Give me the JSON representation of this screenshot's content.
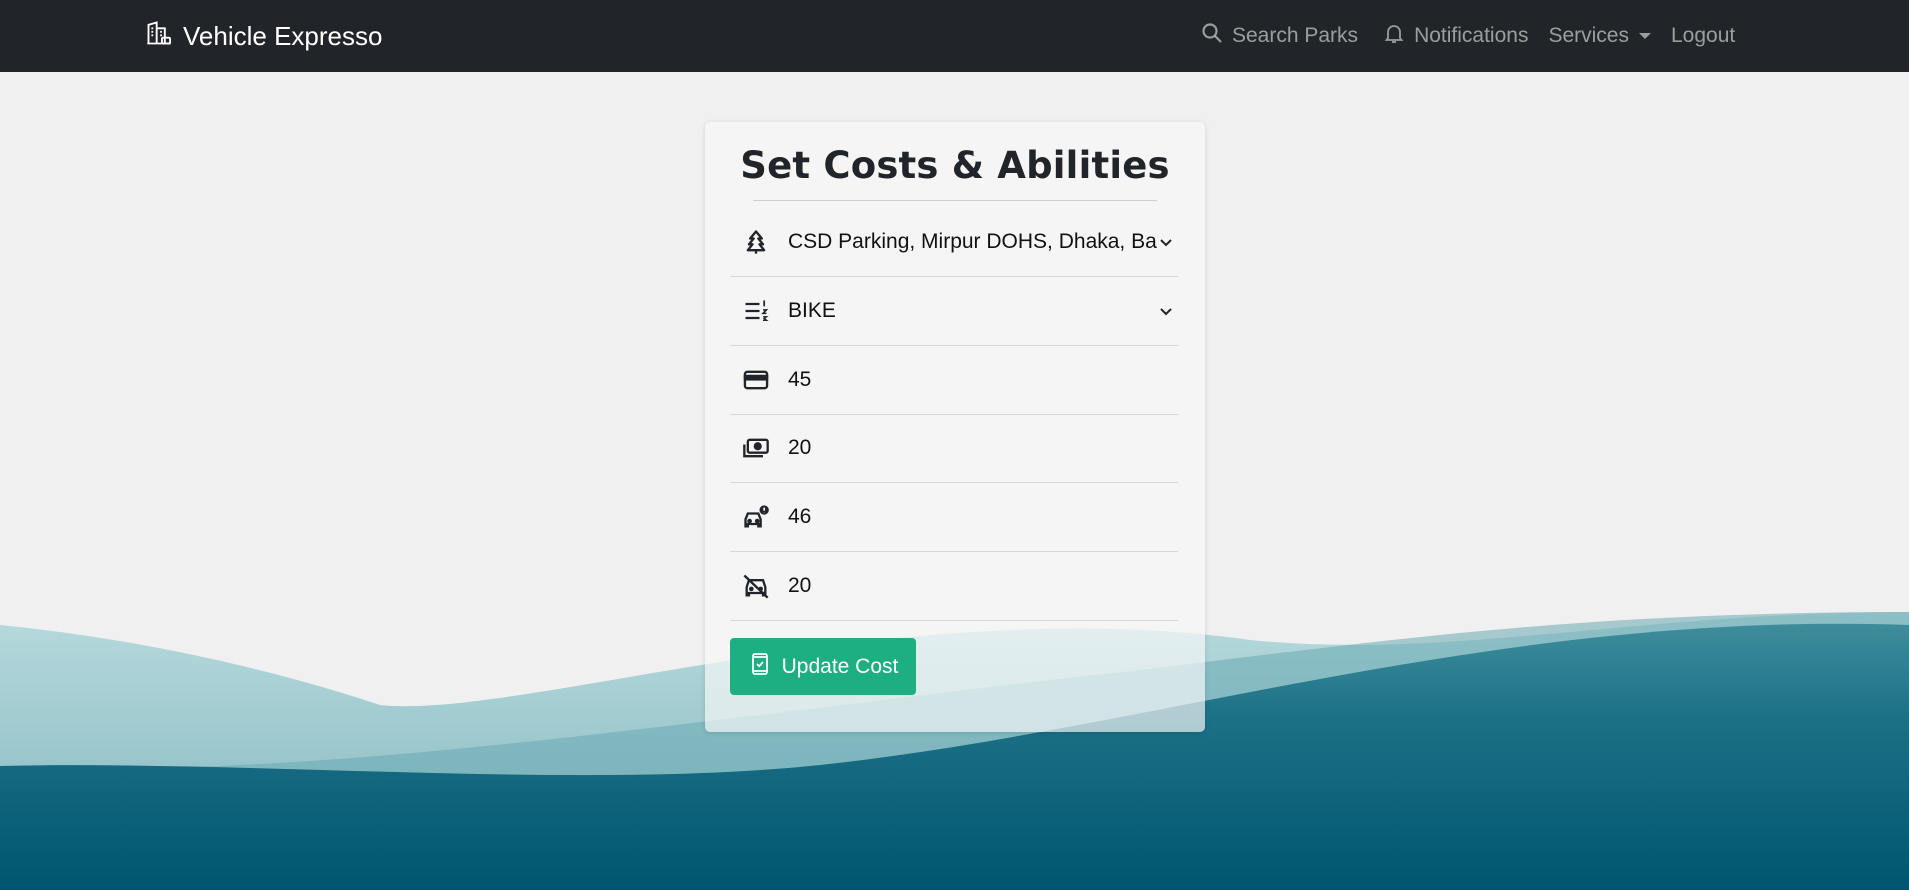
{
  "navbar": {
    "brand": "Vehicle Expresso",
    "brand_icon": "building-icon",
    "search_label": "Search Parks",
    "notifications_label": "Notifications",
    "services_label": "Services",
    "logout_label": "Logout"
  },
  "card": {
    "title": "Set Costs & Abilities",
    "fields": [
      {
        "icon": "tree-icon",
        "value": "CSD Parking, Mirpur DOHS, Dhaka, Bangladesh",
        "type": "select"
      },
      {
        "icon": "list-numbered-icon",
        "value": "BIKE",
        "type": "select"
      },
      {
        "icon": "credit-card-icon",
        "value": "45",
        "type": "input"
      },
      {
        "icon": "cash-icon",
        "value": "20",
        "type": "input"
      },
      {
        "icon": "car-alert-icon",
        "value": "46",
        "type": "input"
      },
      {
        "icon": "no-car-icon",
        "value": "20",
        "type": "input"
      }
    ],
    "button_label": "Update Cost",
    "button_icon": "phone-check-icon"
  },
  "colors": {
    "navbar_bg": "#212529",
    "accent": "#1daf82",
    "wave_dark": "#005570",
    "wave_light": "#b8dadd"
  }
}
